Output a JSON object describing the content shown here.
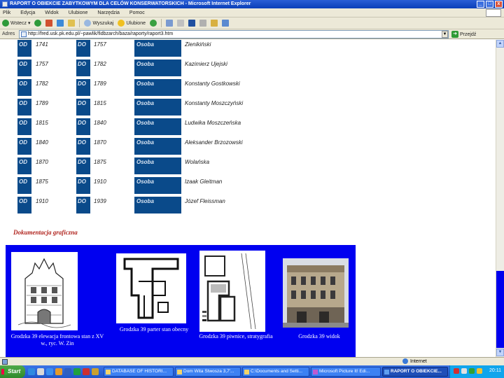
{
  "window": {
    "title": "RAPORT O OBIEKCIE ZABYTKOWYM DLA CELÓW KONSERWATORSKICH - Microsoft Internet Explorer",
    "buttons": [
      "_",
      "□",
      "x"
    ]
  },
  "menu": [
    "Plik",
    "Edycja",
    "Widok",
    "Ulubione",
    "Narzędzia",
    "Pomoc"
  ],
  "toolbar": {
    "back_label": "Wstecz",
    "search_label": "Wyszukaj",
    "favorites_label": "Ulubione"
  },
  "address": {
    "label": "Adres",
    "url": "http://fred.usk.pk.edu.pl/~pawlik/fidbzarch/baza/raporty/raport3.htm",
    "go_label": "Przejdź"
  },
  "records": [
    {
      "od": "OD",
      "from": "1741",
      "do": "DO",
      "to": "1757",
      "kind": "Osoba",
      "name": "Zienikiński"
    },
    {
      "od": "OD",
      "from": "1757",
      "do": "DO",
      "to": "1782",
      "kind": "Osoba",
      "name": "Kazimierz Ujejski"
    },
    {
      "od": "OD",
      "from": "1782",
      "do": "DO",
      "to": "1789",
      "kind": "Osoba",
      "name": "Konstanty Gostkowski"
    },
    {
      "od": "OD",
      "from": "1789",
      "do": "DO",
      "to": "1815",
      "kind": "Osoba",
      "name": "Konstanty Moszczyński"
    },
    {
      "od": "OD",
      "from": "1815",
      "do": "DO",
      "to": "1840",
      "kind": "Osoba",
      "name": "Ludwika Moszczeńska"
    },
    {
      "od": "OD",
      "from": "1840",
      "do": "DO",
      "to": "1870",
      "kind": "Osoba",
      "name": "Aleksander Brzozowski"
    },
    {
      "od": "OD",
      "from": "1870",
      "do": "DO",
      "to": "1875",
      "kind": "Osoba",
      "name": "Wolańska"
    },
    {
      "od": "OD",
      "from": "1875",
      "do": "DO",
      "to": "1910",
      "kind": "Osoba",
      "name": "Izaak Gleitman"
    },
    {
      "od": "OD",
      "from": "1910",
      "do": "DO",
      "to": "1939",
      "kind": "Osoba",
      "name": "Józef Fleissman"
    }
  ],
  "section_title": "Dokumentacja graficzna",
  "gallery": [
    {
      "caption": "Grodzka 39 elewacja frontowa stan z XV w., ryc. W. Zin"
    },
    {
      "caption": "Grodzka 39 parter stan obecny"
    },
    {
      "caption": "Grodzka 39 piwnice, stratygrafia"
    },
    {
      "caption": "Grodzka 39 widok"
    }
  ],
  "status": {
    "zone": "Internet"
  },
  "taskbar": {
    "start": "Start",
    "tasks": [
      "DATABASE OF HISTORI...",
      "Dom Wita Stwosza 3,7'...",
      "C:\\Documents and Setti...",
      "Microsoft Picture It! Edi...",
      "RAPORT O OBIEKCIE..."
    ],
    "clock": "20:11"
  },
  "colors": {
    "tag_blue": "#0a4a8a",
    "gallery_blue": "#0000f0",
    "section_red": "#b0241e"
  }
}
